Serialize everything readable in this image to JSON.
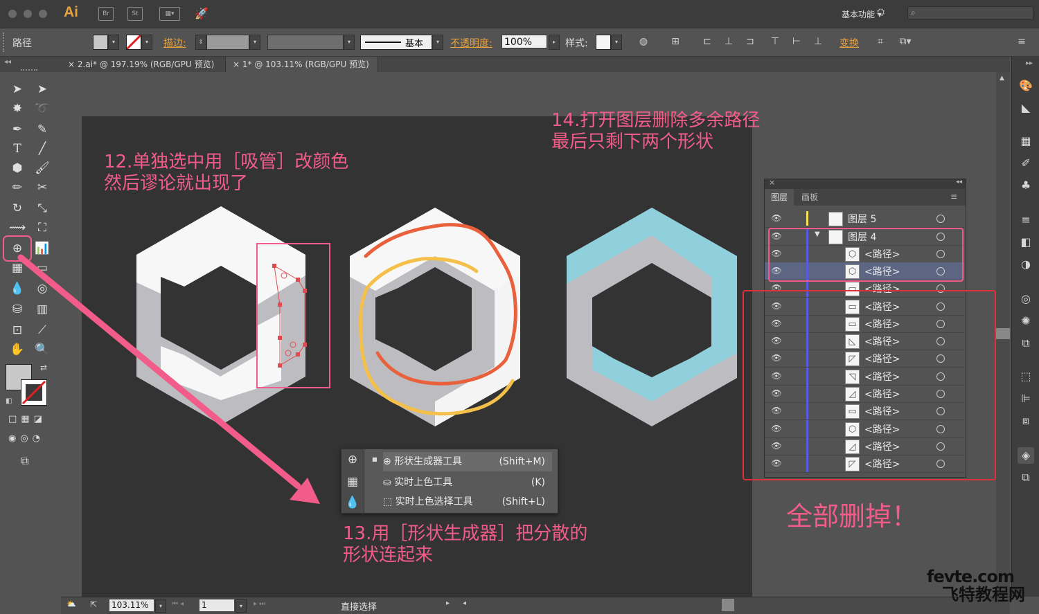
{
  "app": {
    "logo": "Ai",
    "bridge": "Br",
    "stock": "St",
    "workspace": "基本功能"
  },
  "search": {
    "placeholder": ""
  },
  "control_bar": {
    "selection_type": "路径",
    "stroke_label": "描边:",
    "stroke_profile": "基本",
    "opacity_label": "不透明度:",
    "opacity_value": "100%",
    "style_label": "样式:",
    "transform_label": "变换"
  },
  "tabs": [
    {
      "label": "2.ai* @ 197.19% (RGB/GPU 预览)"
    },
    {
      "label": "1* @ 103.11% (RGB/GPU 预览)"
    }
  ],
  "annotations": {
    "step12": "12.单独选中用［吸管］改颜色\n然后谬论就出现了",
    "step13": "13.用［形状生成器］把分散的\n形状连起来",
    "step14": "14.打开图层删除多余路径\n最后只剩下两个形状",
    "delete_all": "全部删掉！"
  },
  "flyout": {
    "items": [
      {
        "label": "形状生成器工具",
        "shortcut": "(Shift+M)"
      },
      {
        "label": "实时上色工具",
        "shortcut": "(K)"
      },
      {
        "label": "实时上色选择工具",
        "shortcut": "(Shift+L)"
      }
    ]
  },
  "layers_panel": {
    "tabs": [
      "图层",
      "画板"
    ],
    "layers": [
      {
        "name": "图层 5"
      },
      {
        "name": "图层 4"
      },
      {
        "name": "<路径>"
      },
      {
        "name": "<路径>"
      },
      {
        "name": "<路径>"
      },
      {
        "name": "<路径>"
      },
      {
        "name": "<路径>"
      },
      {
        "name": "<路径>"
      },
      {
        "name": "<路径>"
      },
      {
        "name": "<路径>"
      },
      {
        "name": "<路径>"
      },
      {
        "name": "<路径>"
      },
      {
        "name": "<路径>"
      },
      {
        "name": "<路径>"
      },
      {
        "name": "<路径>"
      }
    ]
  },
  "status_bar": {
    "zoom": "103.11%",
    "page": "1",
    "tool": "直接选择"
  },
  "watermark": {
    "line1": "fevte.com",
    "line2": "飞特教程网"
  },
  "colors": {
    "accent_pink": "#f25c8a",
    "teal": "#8fd0dc",
    "hex_gray": "#bdbcc0",
    "hex_white": "#f7f7f7",
    "orange_line": "#e8613c",
    "yellow_line": "#f5c04a"
  }
}
